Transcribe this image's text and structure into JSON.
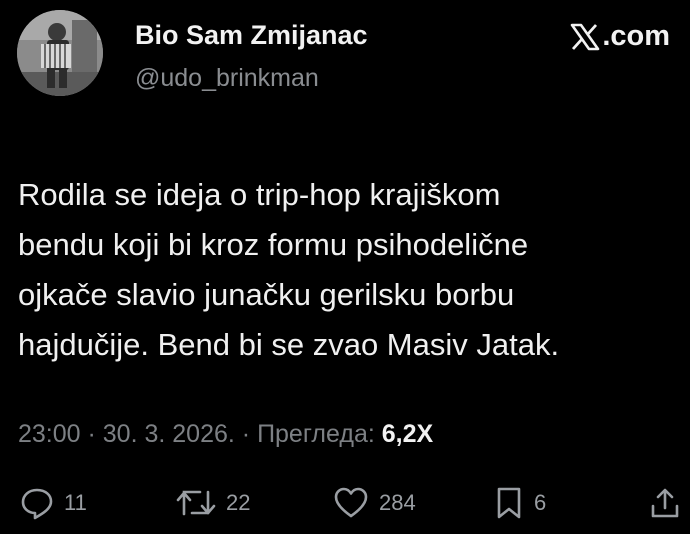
{
  "author": {
    "display_name": "Bio Sam Zmijanac",
    "handle": "@udo_brinkman"
  },
  "brand": {
    "icon": "x-logo-icon",
    "text": ".com"
  },
  "post": {
    "lines": [
      "Rodila se ideja o trip-hop krajiškom",
      "bendu koji bi kroz formu psihodelične",
      "ojkače slavio junačku gerilsku borbu",
      "hajdučije. Bend bi se zvao Masiv Jatak."
    ]
  },
  "meta": {
    "time": "23:00",
    "separator": " · ",
    "date": "30. 3. 2026.",
    "views_label": "Прегледа:",
    "views_count": "6,2X"
  },
  "actions": {
    "replies": {
      "icon": "reply-icon",
      "count": "11"
    },
    "reposts": {
      "icon": "repost-icon",
      "count": "22"
    },
    "likes": {
      "icon": "heart-icon",
      "count": "284"
    },
    "bookmarks": {
      "icon": "bookmark-icon",
      "count": "6"
    },
    "share": {
      "icon": "share-icon"
    }
  },
  "colors": {
    "background": "#000000",
    "text": "#e7e9ea",
    "muted": "#7d8084"
  }
}
